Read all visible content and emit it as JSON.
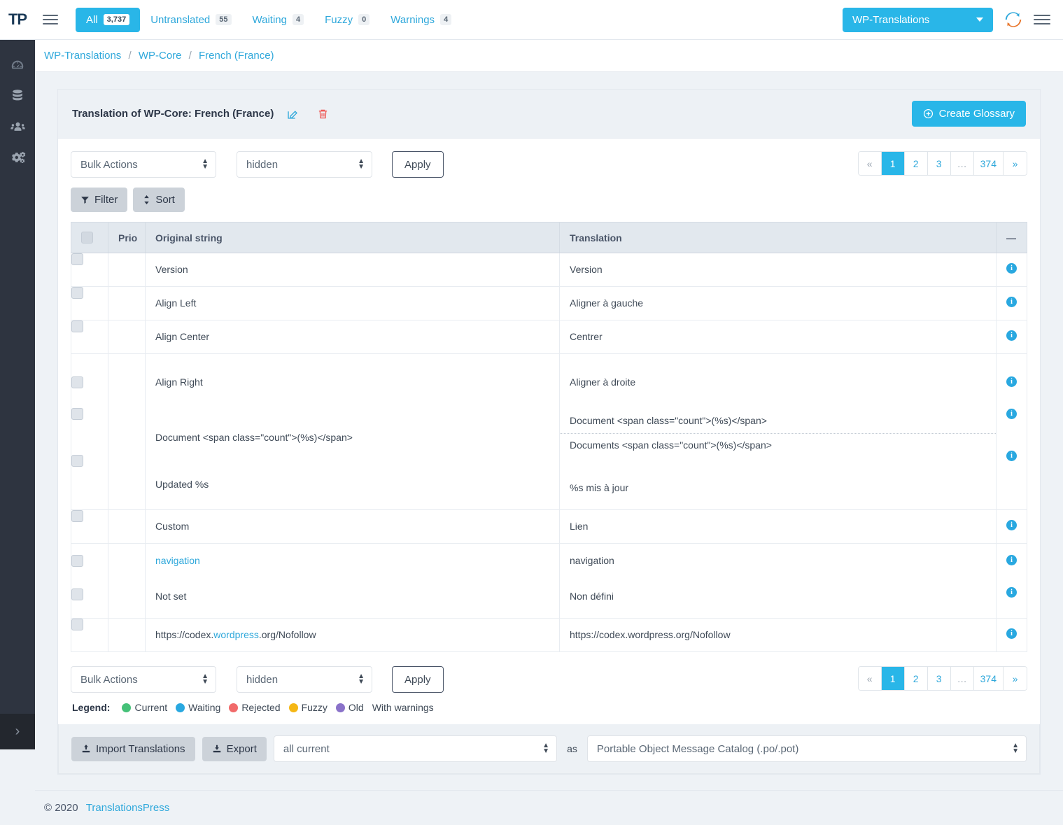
{
  "topbar": {
    "brand": "TP",
    "tabs": [
      {
        "label": "All",
        "count": "3,737",
        "active": true
      },
      {
        "label": "Untranslated",
        "count": "55",
        "active": false
      },
      {
        "label": "Waiting",
        "count": "4",
        "active": false
      },
      {
        "label": "Fuzzy",
        "count": "0",
        "active": false
      },
      {
        "label": "Warnings",
        "count": "4",
        "active": false
      }
    ],
    "project": "WP-Translations",
    "sync_icon": "sync-refresh-icon",
    "menu_icon": "hamburger-menu-icon"
  },
  "rail": {
    "items": [
      {
        "name": "dashboard",
        "icon": "gauge-icon"
      },
      {
        "name": "database",
        "icon": "database-icon"
      },
      {
        "name": "users",
        "icon": "users-icon"
      },
      {
        "name": "settings",
        "icon": "cogs-icon"
      }
    ],
    "toggle": "›"
  },
  "breadcrumb": {
    "items": [
      "WP-Translations",
      "WP-Core",
      "French (France)"
    ],
    "separator": "/"
  },
  "card": {
    "title": "Translation of WP-Core: French (France)",
    "edit_icon": "edit-pencil-icon",
    "delete_icon": "trash-icon",
    "create_glossary": "Create Glossary",
    "plus_icon": "plus-circle-icon"
  },
  "toolbar": {
    "bulk_actions": "Bulk Actions",
    "bulk_actions_options": [
      "Bulk Actions"
    ],
    "hidden_select": "hidden",
    "hidden_options": [
      "hidden"
    ],
    "apply": "Apply",
    "filter": "Filter",
    "filter_icon": "funnel-icon",
    "sort": "Sort",
    "sort_icon": "sort-updown-icon"
  },
  "pagination": {
    "first": "«",
    "last": "»",
    "pages": [
      "1",
      "2",
      "3",
      "…",
      "374"
    ],
    "active": "1"
  },
  "table": {
    "headers": {
      "checkbox": "",
      "prio": "Prio",
      "original": "Original string",
      "translation": "Translation",
      "collapse": "—"
    },
    "groups": [
      {
        "rows": [
          {
            "original": "Version",
            "translation": "Version",
            "original_link": false
          }
        ]
      },
      {
        "rows": [
          {
            "original": "Align Left",
            "translation": "Aligner à gauche",
            "original_link": false
          }
        ]
      },
      {
        "rows": [
          {
            "original": "Align Center",
            "translation": "Centrer",
            "original_link": false
          }
        ]
      },
      {
        "rows": [
          {
            "original": "Align Right",
            "translation": "Aligner à droite",
            "original_link": false
          },
          {
            "original": "Document <span class=\"count\">(%s)</span>",
            "translation": "Document <span class=\"count\">(%s)</span>",
            "translation_plural": "Documents <span class=\"count\">(%s)</span>",
            "original_link": false
          },
          {
            "original": "Updated %s",
            "translation": "%s mis à jour",
            "original_link": false
          }
        ]
      },
      {
        "rows": [
          {
            "original": "Custom",
            "translation": "Lien",
            "original_link": false
          }
        ]
      },
      {
        "rows": [
          {
            "original": "navigation",
            "translation": "navigation",
            "original_link": true
          },
          {
            "original": "Not set",
            "translation": "Non défini",
            "original_link": false
          }
        ]
      },
      {
        "rows": [
          {
            "original": "https://codex.wordpress.org/Nofollow",
            "original_prefix": "https://codex.",
            "original_link_part": "wordpress",
            "original_suffix": ".org/Nofollow",
            "translation": "https://codex.wordpress.org/Nofollow",
            "original_link": "partial"
          }
        ]
      }
    ],
    "info_icon": "info-circle-icon"
  },
  "legend": {
    "label": "Legend:",
    "items": [
      {
        "label": "Current",
        "color": "#45c178"
      },
      {
        "label": "Waiting",
        "color": "#29a8e0"
      },
      {
        "label": "Rejected",
        "color": "#f16a6a"
      },
      {
        "label": "Fuzzy",
        "color": "#f5b715"
      },
      {
        "label": "Old",
        "color": "#8a72c9"
      }
    ],
    "warnings_label": "With warnings"
  },
  "export": {
    "import_label": "Import Translations",
    "import_icon": "upload-icon",
    "export_label": "Export",
    "export_icon": "download-icon",
    "scope_value": "all current",
    "scope_options": [
      "all current"
    ],
    "as_label": "as",
    "format_value": "Portable Object Message Catalog (.po/.pot)",
    "format_options": [
      "Portable Object Message Catalog (.po/.pot)"
    ]
  },
  "footer": {
    "copyright": "© 2020",
    "link": "TranslationsPress"
  }
}
